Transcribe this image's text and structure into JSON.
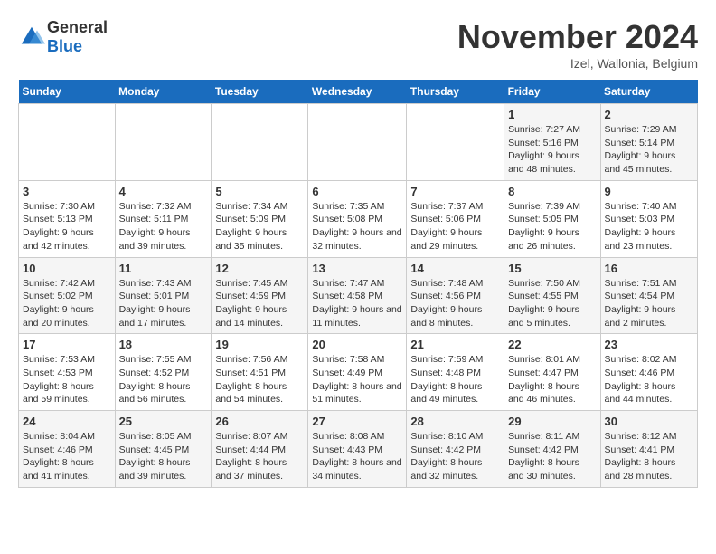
{
  "header": {
    "logo_general": "General",
    "logo_blue": "Blue",
    "month_title": "November 2024",
    "subtitle": "Izel, Wallonia, Belgium"
  },
  "days_of_week": [
    "Sunday",
    "Monday",
    "Tuesday",
    "Wednesday",
    "Thursday",
    "Friday",
    "Saturday"
  ],
  "weeks": [
    [
      {
        "day": "",
        "info": ""
      },
      {
        "day": "",
        "info": ""
      },
      {
        "day": "",
        "info": ""
      },
      {
        "day": "",
        "info": ""
      },
      {
        "day": "",
        "info": ""
      },
      {
        "day": "1",
        "info": "Sunrise: 7:27 AM\nSunset: 5:16 PM\nDaylight: 9 hours and 48 minutes."
      },
      {
        "day": "2",
        "info": "Sunrise: 7:29 AM\nSunset: 5:14 PM\nDaylight: 9 hours and 45 minutes."
      }
    ],
    [
      {
        "day": "3",
        "info": "Sunrise: 7:30 AM\nSunset: 5:13 PM\nDaylight: 9 hours and 42 minutes."
      },
      {
        "day": "4",
        "info": "Sunrise: 7:32 AM\nSunset: 5:11 PM\nDaylight: 9 hours and 39 minutes."
      },
      {
        "day": "5",
        "info": "Sunrise: 7:34 AM\nSunset: 5:09 PM\nDaylight: 9 hours and 35 minutes."
      },
      {
        "day": "6",
        "info": "Sunrise: 7:35 AM\nSunset: 5:08 PM\nDaylight: 9 hours and 32 minutes."
      },
      {
        "day": "7",
        "info": "Sunrise: 7:37 AM\nSunset: 5:06 PM\nDaylight: 9 hours and 29 minutes."
      },
      {
        "day": "8",
        "info": "Sunrise: 7:39 AM\nSunset: 5:05 PM\nDaylight: 9 hours and 26 minutes."
      },
      {
        "day": "9",
        "info": "Sunrise: 7:40 AM\nSunset: 5:03 PM\nDaylight: 9 hours and 23 minutes."
      }
    ],
    [
      {
        "day": "10",
        "info": "Sunrise: 7:42 AM\nSunset: 5:02 PM\nDaylight: 9 hours and 20 minutes."
      },
      {
        "day": "11",
        "info": "Sunrise: 7:43 AM\nSunset: 5:01 PM\nDaylight: 9 hours and 17 minutes."
      },
      {
        "day": "12",
        "info": "Sunrise: 7:45 AM\nSunset: 4:59 PM\nDaylight: 9 hours and 14 minutes."
      },
      {
        "day": "13",
        "info": "Sunrise: 7:47 AM\nSunset: 4:58 PM\nDaylight: 9 hours and 11 minutes."
      },
      {
        "day": "14",
        "info": "Sunrise: 7:48 AM\nSunset: 4:56 PM\nDaylight: 9 hours and 8 minutes."
      },
      {
        "day": "15",
        "info": "Sunrise: 7:50 AM\nSunset: 4:55 PM\nDaylight: 9 hours and 5 minutes."
      },
      {
        "day": "16",
        "info": "Sunrise: 7:51 AM\nSunset: 4:54 PM\nDaylight: 9 hours and 2 minutes."
      }
    ],
    [
      {
        "day": "17",
        "info": "Sunrise: 7:53 AM\nSunset: 4:53 PM\nDaylight: 8 hours and 59 minutes."
      },
      {
        "day": "18",
        "info": "Sunrise: 7:55 AM\nSunset: 4:52 PM\nDaylight: 8 hours and 56 minutes."
      },
      {
        "day": "19",
        "info": "Sunrise: 7:56 AM\nSunset: 4:51 PM\nDaylight: 8 hours and 54 minutes."
      },
      {
        "day": "20",
        "info": "Sunrise: 7:58 AM\nSunset: 4:49 PM\nDaylight: 8 hours and 51 minutes."
      },
      {
        "day": "21",
        "info": "Sunrise: 7:59 AM\nSunset: 4:48 PM\nDaylight: 8 hours and 49 minutes."
      },
      {
        "day": "22",
        "info": "Sunrise: 8:01 AM\nSunset: 4:47 PM\nDaylight: 8 hours and 46 minutes."
      },
      {
        "day": "23",
        "info": "Sunrise: 8:02 AM\nSunset: 4:46 PM\nDaylight: 8 hours and 44 minutes."
      }
    ],
    [
      {
        "day": "24",
        "info": "Sunrise: 8:04 AM\nSunset: 4:46 PM\nDaylight: 8 hours and 41 minutes."
      },
      {
        "day": "25",
        "info": "Sunrise: 8:05 AM\nSunset: 4:45 PM\nDaylight: 8 hours and 39 minutes."
      },
      {
        "day": "26",
        "info": "Sunrise: 8:07 AM\nSunset: 4:44 PM\nDaylight: 8 hours and 37 minutes."
      },
      {
        "day": "27",
        "info": "Sunrise: 8:08 AM\nSunset: 4:43 PM\nDaylight: 8 hours and 34 minutes."
      },
      {
        "day": "28",
        "info": "Sunrise: 8:10 AM\nSunset: 4:42 PM\nDaylight: 8 hours and 32 minutes."
      },
      {
        "day": "29",
        "info": "Sunrise: 8:11 AM\nSunset: 4:42 PM\nDaylight: 8 hours and 30 minutes."
      },
      {
        "day": "30",
        "info": "Sunrise: 8:12 AM\nSunset: 4:41 PM\nDaylight: 8 hours and 28 minutes."
      }
    ]
  ]
}
